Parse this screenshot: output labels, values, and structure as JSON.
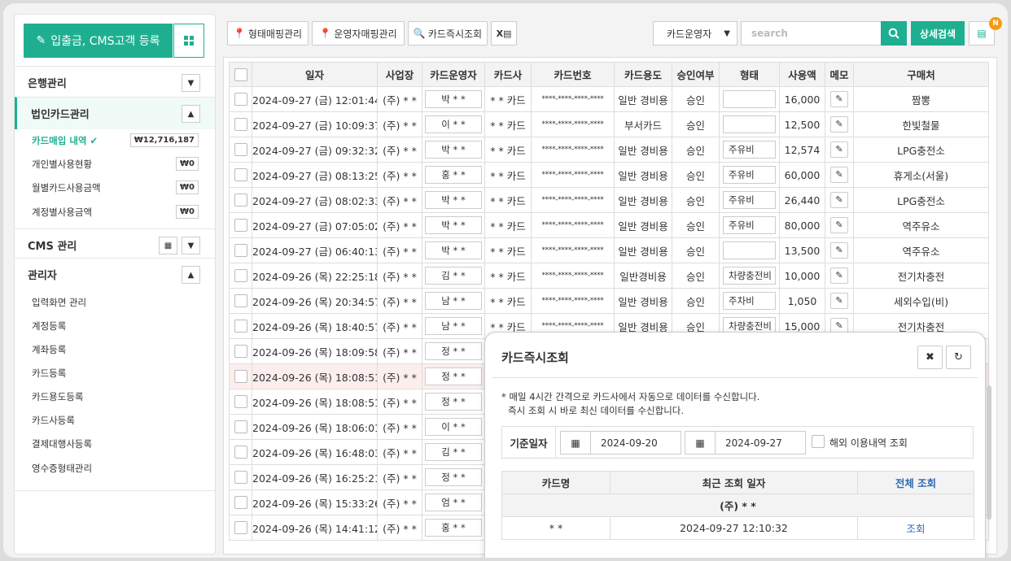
{
  "sidebar": {
    "register_button": "입출금, CMS고객 등록",
    "sections": [
      {
        "label": "은행관리",
        "toggle": "⌄"
      },
      {
        "label": "법인카드관리",
        "toggle": "⌃"
      },
      {
        "label": "CMS 관리",
        "toggle": "⌄"
      },
      {
        "label": "관리자",
        "toggle": "⌃"
      }
    ],
    "card_items": [
      {
        "label": "카드매입 내역",
        "amount": "₩12,716,187"
      },
      {
        "label": "개인별사용현황",
        "amount": "₩0"
      },
      {
        "label": "월별카드사용금액",
        "amount": "₩0"
      },
      {
        "label": "계정별사용금액",
        "amount": "₩0"
      }
    ],
    "admin_items": [
      "입력화면 관리",
      "계정등록",
      "계좌등록",
      "카드등록",
      "카드용도등록",
      "카드사등록",
      "결제대행사등록",
      "영수증형태관리"
    ]
  },
  "toolbar": {
    "type_mapping": "형태매핑관리",
    "operator_mapping": "운영자매핑관리",
    "card_lookup": "카드즉시조회",
    "filter_select": "카드운영자",
    "search_placeholder": "search",
    "advanced_search": "상세검색",
    "badge": "N"
  },
  "table": {
    "headers": [
      "일자",
      "사업장",
      "카드운영자",
      "카드사",
      "카드번호",
      "카드용도",
      "승인여부",
      "형태",
      "사용액",
      "메모",
      "구매처"
    ],
    "rows": [
      {
        "date": "2024-09-27 (금) 12:01:44",
        "biz": "(주) * *",
        "op": "박 * *",
        "co": "* * 카드",
        "num": "****-****-****-****",
        "use": "일반 경비용",
        "appr": "승인",
        "type": "",
        "amt": "16,000",
        "vendor": "짬뽕"
      },
      {
        "date": "2024-09-27 (금) 10:09:37",
        "biz": "(주) * *",
        "op": "이 * *",
        "co": "* * 카드",
        "num": "****-****-****-****",
        "use": "부서카드",
        "appr": "승인",
        "type": "",
        "amt": "12,500",
        "vendor": "한빛철물"
      },
      {
        "date": "2024-09-27 (금) 09:32:32",
        "biz": "(주) * *",
        "op": "박 * *",
        "co": "* * 카드",
        "num": "****-****-****-****",
        "use": "일반 경비용",
        "appr": "승인",
        "type": "주유비",
        "amt": "12,574",
        "vendor": "LPG충전소"
      },
      {
        "date": "2024-09-27 (금) 08:13:25",
        "biz": "(주) * *",
        "op": "홍 * *",
        "co": "* * 카드",
        "num": "****-****-****-****",
        "use": "일반 경비용",
        "appr": "승인",
        "type": "주유비",
        "amt": "60,000",
        "vendor": "휴게소(서울)"
      },
      {
        "date": "2024-09-27 (금) 08:02:33",
        "biz": "(주) * *",
        "op": "박 * *",
        "co": "* * 카드",
        "num": "****-****-****-****",
        "use": "일반 경비용",
        "appr": "승인",
        "type": "주유비",
        "amt": "26,440",
        "vendor": "LPG충전소"
      },
      {
        "date": "2024-09-27 (금) 07:05:02",
        "biz": "(주) * *",
        "op": "박 * *",
        "co": "* * 카드",
        "num": "****-****-****-****",
        "use": "일반 경비용",
        "appr": "승인",
        "type": "주유비",
        "amt": "80,000",
        "vendor": "역주유소"
      },
      {
        "date": "2024-09-27 (금) 06:40:13",
        "biz": "(주) * *",
        "op": "박 * *",
        "co": "* * 카드",
        "num": "****-****-****-****",
        "use": "일반 경비용",
        "appr": "승인",
        "type": "",
        "amt": "13,500",
        "vendor": "역주유소"
      },
      {
        "date": "2024-09-26 (목) 22:25:18",
        "biz": "(주) * *",
        "op": "김 * *",
        "co": "* * 카드",
        "num": "****-****-****-****",
        "use": "일반경비용",
        "appr": "승인",
        "type": "차량충전비",
        "amt": "10,000",
        "vendor": "전기차충전"
      },
      {
        "date": "2024-09-26 (목) 20:34:57",
        "biz": "(주) * *",
        "op": "남 * *",
        "co": "* * 카드",
        "num": "****-****-****-****",
        "use": "일반 경비용",
        "appr": "승인",
        "type": "주차비",
        "amt": "1,050",
        "vendor": "세외수입(비)"
      },
      {
        "date": "2024-09-26 (목) 18:40:57",
        "biz": "(주) * *",
        "op": "남 * *",
        "co": "* * 카드",
        "num": "****-****-****-****",
        "use": "일반 경비용",
        "appr": "승인",
        "type": "차량충전비",
        "amt": "15,000",
        "vendor": "전기차충전"
      },
      {
        "date": "2024-09-26 (목) 18:09:58",
        "biz": "(주) * *",
        "op": "정 * *"
      },
      {
        "date": "2024-09-26 (목) 18:08:51",
        "biz": "(주) * *",
        "op": "정 * *"
      },
      {
        "date": "2024-09-26 (목) 18:08:51",
        "biz": "(주) * *",
        "op": "정 * *"
      },
      {
        "date": "2024-09-26 (목) 18:06:01",
        "biz": "(주) * *",
        "op": "이 * *"
      },
      {
        "date": "2024-09-26 (목) 16:48:03",
        "biz": "(주) * *",
        "op": "김 * *"
      },
      {
        "date": "2024-09-26 (목) 16:25:21",
        "biz": "(주) * *",
        "op": "정 * *"
      },
      {
        "date": "2024-09-26 (목) 15:33:26",
        "biz": "(주) * *",
        "op": "엄 * *"
      },
      {
        "date": "2024-09-26 (목) 14:41:12",
        "biz": "(주) * *",
        "op": "홍 * *"
      }
    ]
  },
  "modal": {
    "title": "카드즉시조회",
    "note1": "* 매일 4시간 간격으로 카드사에서 자동으로 데이터를 수신합니다.",
    "note2": "즉시 조회 시 바로 최신 데이터를 수신합니다.",
    "date_label": "기준일자",
    "start_date": "2024-09-20",
    "end_date": "2024-09-27",
    "overseas": "해외 이용내역 조회",
    "col_card": "카드명",
    "col_recent": "최근 조회 일자",
    "col_all": "전체 조회",
    "group": "(주) * *",
    "card_name": "* *",
    "recent": "2024-09-27 12:10:32",
    "lookup": "조회"
  }
}
